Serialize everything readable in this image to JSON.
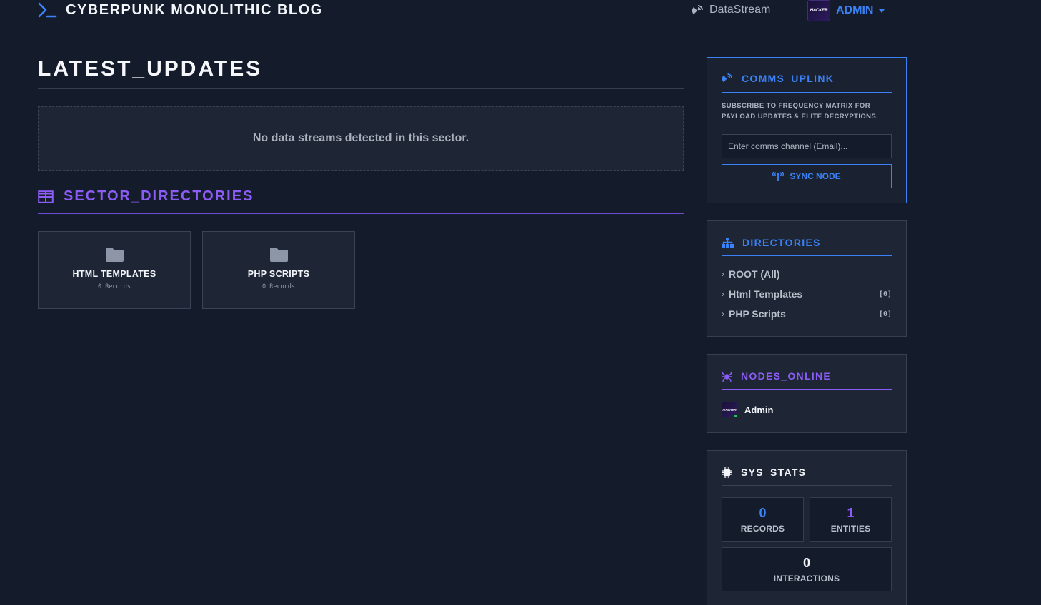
{
  "header": {
    "brand_title": "CYBERPUNK MONOLITHIC BLOG",
    "datastream_label": "DataStream",
    "avatar_text": "HACKER",
    "user_label": "ADMIN"
  },
  "main": {
    "title": "LATEST_UPDATES",
    "empty_message": "No data streams detected in this sector.",
    "sector_title": "SECTOR_DIRECTORIES",
    "categories": [
      {
        "name": "HTML TEMPLATES",
        "count": "0 Records"
      },
      {
        "name": "PHP SCRIPTS",
        "count": "0 Records"
      }
    ]
  },
  "sidebar": {
    "comms": {
      "title": "COMMS_UPLINK",
      "description": "SUBSCRIBE TO FREQUENCY MATRIX FOR PAYLOAD UPDATES & ELITE DECRYPTIONS.",
      "email_placeholder": "Enter comms channel (Email)...",
      "button_label": "SYNC NODE"
    },
    "directories": {
      "title": "DIRECTORIES",
      "items": [
        {
          "label": "ROOT (All)",
          "count": ""
        },
        {
          "label": "Html Templates",
          "count": "[0]"
        },
        {
          "label": "PHP Scripts",
          "count": "[0]"
        }
      ]
    },
    "nodes": {
      "title": "NODES_ONLINE",
      "avatar_text": "HACKER",
      "user": "Admin"
    },
    "stats": {
      "title": "SYS_STATS",
      "records_value": "0",
      "records_label": "RECORDS",
      "entities_value": "1",
      "entities_label": "ENTITIES",
      "interactions_value": "0",
      "interactions_label": "INTERACTIONS"
    }
  },
  "colors": {
    "background": "#141b2a",
    "panel": "#1e2636",
    "accent_blue": "#3b82f6",
    "accent_purple": "#8b5cf6",
    "online": "#22c55e"
  },
  "icons": {
    "brand": "terminal-prompt-icon",
    "datastream": "satellite-dish-icon",
    "sector": "grid-icon",
    "category": "folder-icon",
    "comms": "satellite-dish-icon",
    "sync": "broadcast-tower-icon",
    "directories": "sitemap-icon",
    "nodes": "spider-icon",
    "stats": "microchip-icon",
    "dir_item": "chevron-right-icon"
  }
}
